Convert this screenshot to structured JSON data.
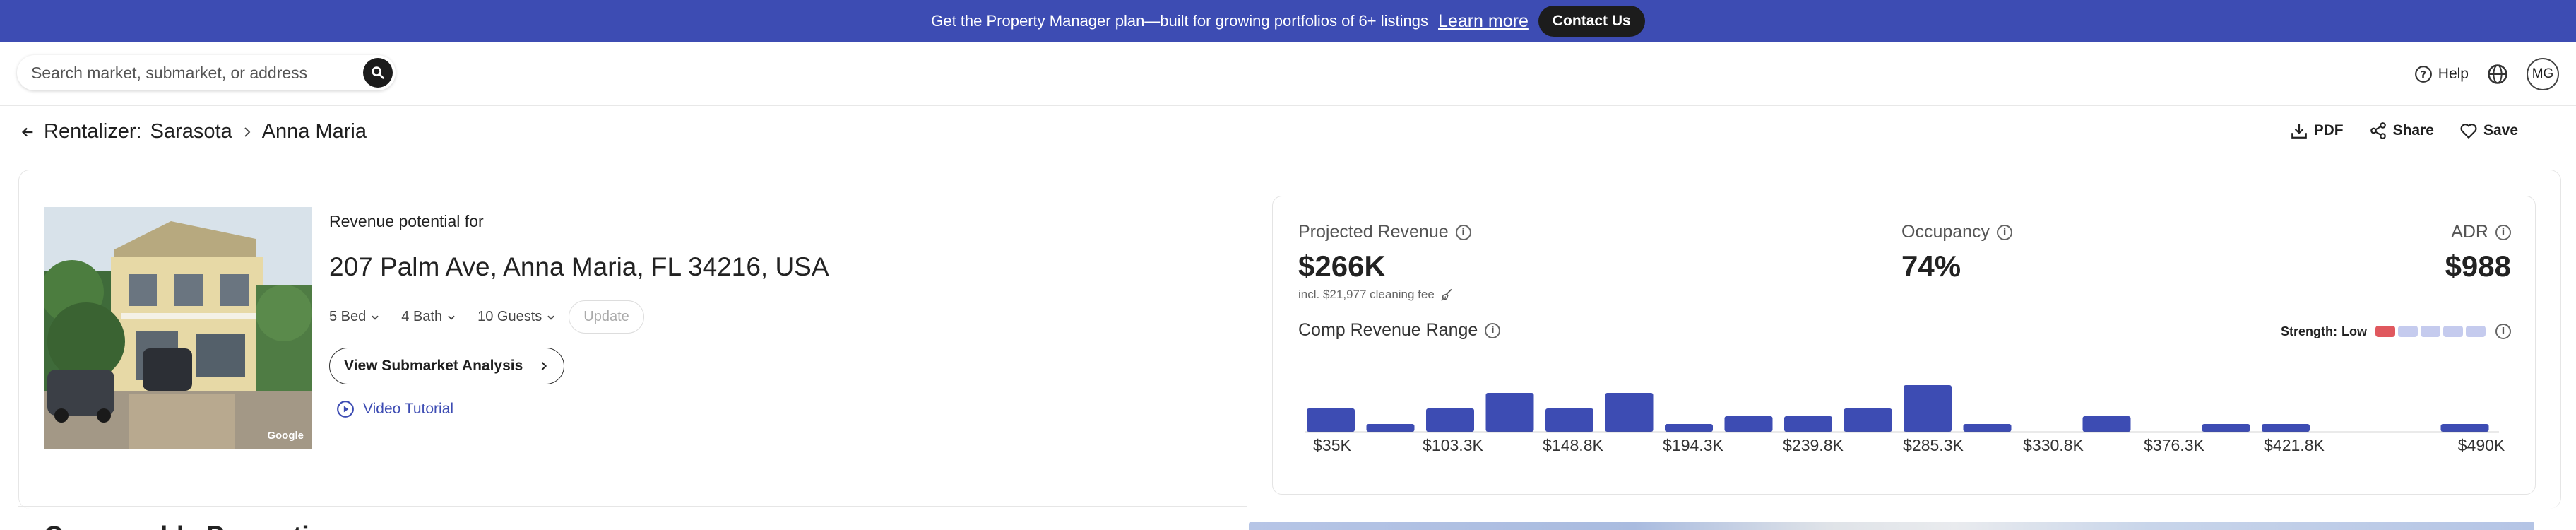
{
  "banner": {
    "text": "Get the Property Manager plan—built for growing portfolios of 6+ listings",
    "learn_more": "Learn more",
    "contact": "Contact Us",
    "bg_color": "#3d4cb3"
  },
  "search": {
    "placeholder": "Search market, submarket, or address",
    "icon": "search-icon"
  },
  "top_nav": {
    "help": "Help",
    "avatar": "MG"
  },
  "breadcrumb": {
    "root": "Rentalizer:",
    "city": "Sarasota",
    "area": "Anna Maria"
  },
  "actions": {
    "pdf": "PDF",
    "share": "Share",
    "save": "Save"
  },
  "property": {
    "photo_credit": "Google",
    "revenue_label": "Revenue potential for",
    "address": "207 Palm Ave, Anna Maria, FL 34216, USA",
    "beds": "5 Bed",
    "baths": "4 Bath",
    "guests": "10 Guests",
    "update": "Update",
    "submarket_button": "View Submarket Analysis",
    "video": "Video Tutorial"
  },
  "metrics": {
    "projected_revenue_label": "Projected Revenue",
    "projected_revenue": "$266K",
    "cleaning_fee": "incl. $21,977 cleaning fee",
    "occupancy_label": "Occupancy",
    "occupancy": "74%",
    "adr_label": "ADR",
    "adr": "$988",
    "comp_range_label": "Comp Revenue Range",
    "strength_label": "Strength:",
    "strength_value": "Low",
    "strength_level": 1,
    "strength_total": 5
  },
  "chart_data": {
    "type": "bar",
    "title": "Comp Revenue Range",
    "tick_labels": [
      "$35K",
      "$103.3K",
      "$148.8K",
      "$194.3K",
      "$239.8K",
      "$285.3K",
      "$330.8K",
      "$376.3K",
      "$421.8K",
      "$490K"
    ],
    "values": [
      3,
      1,
      3,
      5,
      3,
      5,
      1,
      2,
      2,
      3,
      6,
      1,
      0,
      2,
      0,
      1,
      1,
      0,
      0,
      1
    ],
    "bar_color": "#3d4cb3",
    "grid": false
  },
  "section": {
    "title": "Comparable Properties"
  }
}
